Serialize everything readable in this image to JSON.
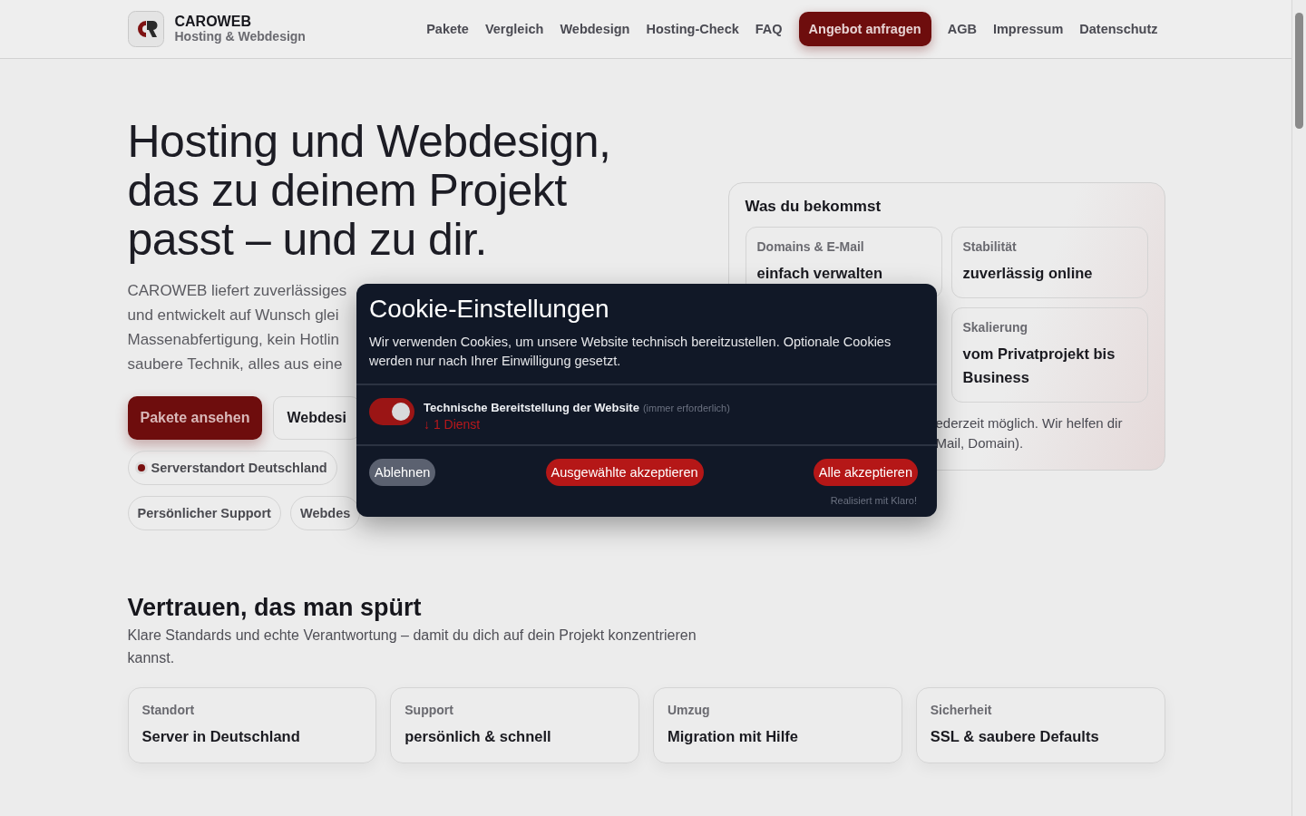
{
  "header": {
    "brand": "CAROWEB",
    "tagline": "Hosting & Webdesign",
    "nav": [
      {
        "label": "Pakete",
        "kind": "link"
      },
      {
        "label": "Vergleich",
        "kind": "link"
      },
      {
        "label": "Webdesign",
        "kind": "link"
      },
      {
        "label": "Hosting-Check",
        "kind": "link"
      },
      {
        "label": "FAQ",
        "kind": "link"
      },
      {
        "label": "Angebot anfragen",
        "kind": "cta"
      },
      {
        "label": "AGB",
        "kind": "link"
      },
      {
        "label": "Impressum",
        "kind": "link"
      },
      {
        "label": "Datenschutz",
        "kind": "link"
      }
    ]
  },
  "hero": {
    "heading": "Hosting und Webdesign, das zu deinem Projekt passt – und zu dir.",
    "lines": [
      "CAROWEB liefert zuverlässiges",
      "und entwickelt auf Wunsch glei",
      "Massenabfertigung, kein Hotlin",
      "saubere Technik, alles aus eine"
    ],
    "buttons": [
      {
        "label": "Pakete ansehen",
        "kind": "primary"
      },
      {
        "label": "Webdesi",
        "kind": "secondary"
      }
    ],
    "chips": [
      [
        {
          "label": "Serverstandort Deutschland",
          "dot": true
        }
      ],
      [
        {
          "label": "Persönlicher Support",
          "dot": false
        },
        {
          "label": "Webdes",
          "dot": false
        }
      ]
    ]
  },
  "benefits": {
    "title": "Was du bekommst",
    "items": [
      {
        "label": "Domains & E-Mail",
        "value": "einfach verwalten"
      },
      {
        "label": "Stabilität",
        "value": "zuverlässig online"
      },
      {
        "label": "Skalierung",
        "value": "vom Privatprojekt bis Business"
      }
    ],
    "note_lines": [
      "ederzeit möglich. Wir helfen dir",
      "Mail, Domain)."
    ]
  },
  "trust": {
    "title": "Vertrauen, das man spürt",
    "subtitle": "Klare Standards und echte Verantwortung – damit du dich auf dein Projekt konzentrieren kannst.",
    "cards": [
      {
        "label": "Standort",
        "value": "Server in Deutschland"
      },
      {
        "label": "Support",
        "value": "persönlich & schnell"
      },
      {
        "label": "Umzug",
        "value": "Migration mit Hilfe"
      },
      {
        "label": "Sicherheit",
        "value": "SSL & saubere Defaults"
      }
    ]
  },
  "cookie_dialog": {
    "title": "Cookie-Einstellungen",
    "text": "Wir verwenden Cookies, um unsere Website technisch bereitzustellen. Optionale Cookies werden nur nach Ihrer Einwilligung gesetzt.",
    "services": [
      {
        "title": "Technische Bereitstellung der Website",
        "note": "(immer erforderlich)",
        "count": "↓ 1 Dienst",
        "on": true
      }
    ],
    "buttons": [
      {
        "label": "Ablehnen",
        "kind": "decline"
      },
      {
        "label": "Ausgewählte akzeptieren",
        "kind": "accept"
      },
      {
        "label": "Alle akzeptieren",
        "kind": "accept"
      }
    ],
    "footer": "Realisiert mit Klaro!"
  }
}
